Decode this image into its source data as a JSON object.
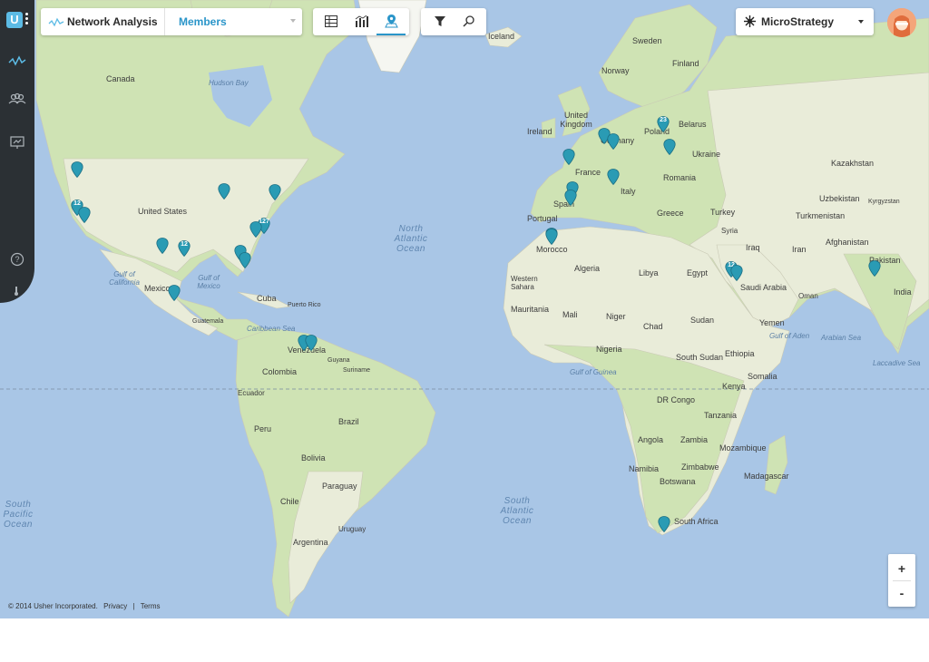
{
  "header": {
    "app_title": "Network Analysis",
    "members_select": "Members",
    "org_name": "MicroStrategy"
  },
  "sidebar": {
    "logo": "U",
    "items": [
      {
        "icon": "network-activity-icon"
      },
      {
        "icon": "users-group-icon"
      },
      {
        "icon": "presentation-icon"
      },
      {
        "icon": "help-icon"
      }
    ]
  },
  "view_toolbar": [
    {
      "icon": "grid-icon"
    },
    {
      "icon": "bar-chart-icon"
    },
    {
      "icon": "map-pin-icon",
      "active": true
    }
  ],
  "tools": [
    {
      "icon": "filter-icon"
    },
    {
      "icon": "search-icon"
    }
  ],
  "map": {
    "oceans": {
      "north_atlantic": "North Atlantic Ocean",
      "south_atlantic": "South Atlantic Ocean",
      "south_pacific": "South Pacific Ocean"
    },
    "seas": {
      "hudson_bay": "Hudson Bay",
      "gulf_mexico": "Gulf of Mexico",
      "gulf_california": "Gulf of California",
      "caribbean": "Caribbean Sea",
      "gulf_aden": "Gulf of Aden",
      "arabian_sea": "Arabian Sea",
      "laccadive": "Laccadive Sea",
      "gulf_guinea": "Gulf of Guinea"
    },
    "countries": {
      "canada": "Canada",
      "united_states": "United States",
      "mexico": "Mexico",
      "cuba": "Cuba",
      "guatemala": "Guatemala",
      "puerto_rico": "Puerto Rico",
      "venezuela": "Venezuela",
      "colombia": "Colombia",
      "guyana": "Guyana",
      "suriname": "Suriname",
      "ecuador": "Ecuador",
      "peru": "Peru",
      "brazil": "Brazil",
      "bolivia": "Bolivia",
      "paraguay": "Paraguay",
      "chile": "Chile",
      "argentina": "Argentina",
      "uruguay": "Uruguay",
      "iceland": "Iceland",
      "ireland": "Ireland",
      "united_kingdom": "United Kingdom",
      "norway": "Norway",
      "sweden": "Sweden",
      "finland": "Finland",
      "germany": "Germany",
      "poland": "Poland",
      "belarus": "Belarus",
      "ukraine": "Ukraine",
      "france": "France",
      "italy": "Italy",
      "spain": "Spain",
      "portugal": "Portugal",
      "romania": "Romania",
      "greece": "Greece",
      "turkey": "Turkey",
      "kazakhstan": "Kazakhstan",
      "uzbekistan": "Uzbekistan",
      "turkmenistan": "Turkmenistan",
      "kyrgyzstan": "Kyrgyzstan",
      "afghanistan": "Afghanistan",
      "pakistan": "Pakistan",
      "india": "India",
      "iran": "Iran",
      "iraq": "Iraq",
      "syria": "Syria",
      "saudi_arabia": "Saudi Arabia",
      "yemen": "Yemen",
      "oman": "Oman",
      "morocco": "Morocco",
      "algeria": "Algeria",
      "libya": "Libya",
      "egypt": "Egypt",
      "western_sahara": "Western Sahara",
      "mauritania": "Mauritania",
      "mali": "Mali",
      "niger": "Niger",
      "chad": "Chad",
      "sudan": "Sudan",
      "south_sudan": "South Sudan",
      "ethiopia": "Ethiopia",
      "somalia": "Somalia",
      "nigeria": "Nigeria",
      "kenya": "Kenya",
      "dr_congo": "DR Congo",
      "tanzania": "Tanzania",
      "angola": "Angola",
      "zambia": "Zambia",
      "mozambique": "Mozambique",
      "zimbabwe": "Zimbabwe",
      "namibia": "Namibia",
      "botswana": "Botswana",
      "south_africa": "South Africa",
      "madagascar": "Madagascar"
    },
    "pins": [
      {
        "name": "seattle",
        "count": ""
      },
      {
        "name": "san-francisco",
        "count": "12"
      },
      {
        "name": "los-angeles",
        "count": ""
      },
      {
        "name": "dallas",
        "count": ""
      },
      {
        "name": "houston",
        "count": "12"
      },
      {
        "name": "chicago",
        "count": ""
      },
      {
        "name": "new-york",
        "count": ""
      },
      {
        "name": "washington",
        "count": "127"
      },
      {
        "name": "atlanta",
        "count": ""
      },
      {
        "name": "orlando",
        "count": ""
      },
      {
        "name": "tampa",
        "count": ""
      },
      {
        "name": "mexico-city",
        "count": ""
      },
      {
        "name": "caracas",
        "count": ""
      },
      {
        "name": "caracas-2",
        "count": ""
      },
      {
        "name": "london",
        "count": ""
      },
      {
        "name": "paris",
        "count": ""
      },
      {
        "name": "amsterdam",
        "count": ""
      },
      {
        "name": "frankfurt",
        "count": ""
      },
      {
        "name": "warsaw",
        "count": "23"
      },
      {
        "name": "kiev",
        "count": ""
      },
      {
        "name": "milan",
        "count": ""
      },
      {
        "name": "barcelona",
        "count": ""
      },
      {
        "name": "madrid",
        "count": ""
      },
      {
        "name": "casablanca",
        "count": ""
      },
      {
        "name": "riyadh",
        "count": "12"
      },
      {
        "name": "jeddah",
        "count": ""
      },
      {
        "name": "delhi",
        "count": ""
      },
      {
        "name": "cape-town",
        "count": ""
      }
    ]
  },
  "zoom": {
    "in": "+",
    "out": "-"
  },
  "footer": {
    "copyright": "© 2014 Usher Incorporated.",
    "privacy": "Privacy",
    "separator": "|",
    "terms": "Terms"
  },
  "colors": {
    "accent": "#2a95c9",
    "pin": "#2a9bb4",
    "ocean": "#a9c6e6",
    "land": "#e9ecd9",
    "sidebar": "#2b3034"
  }
}
